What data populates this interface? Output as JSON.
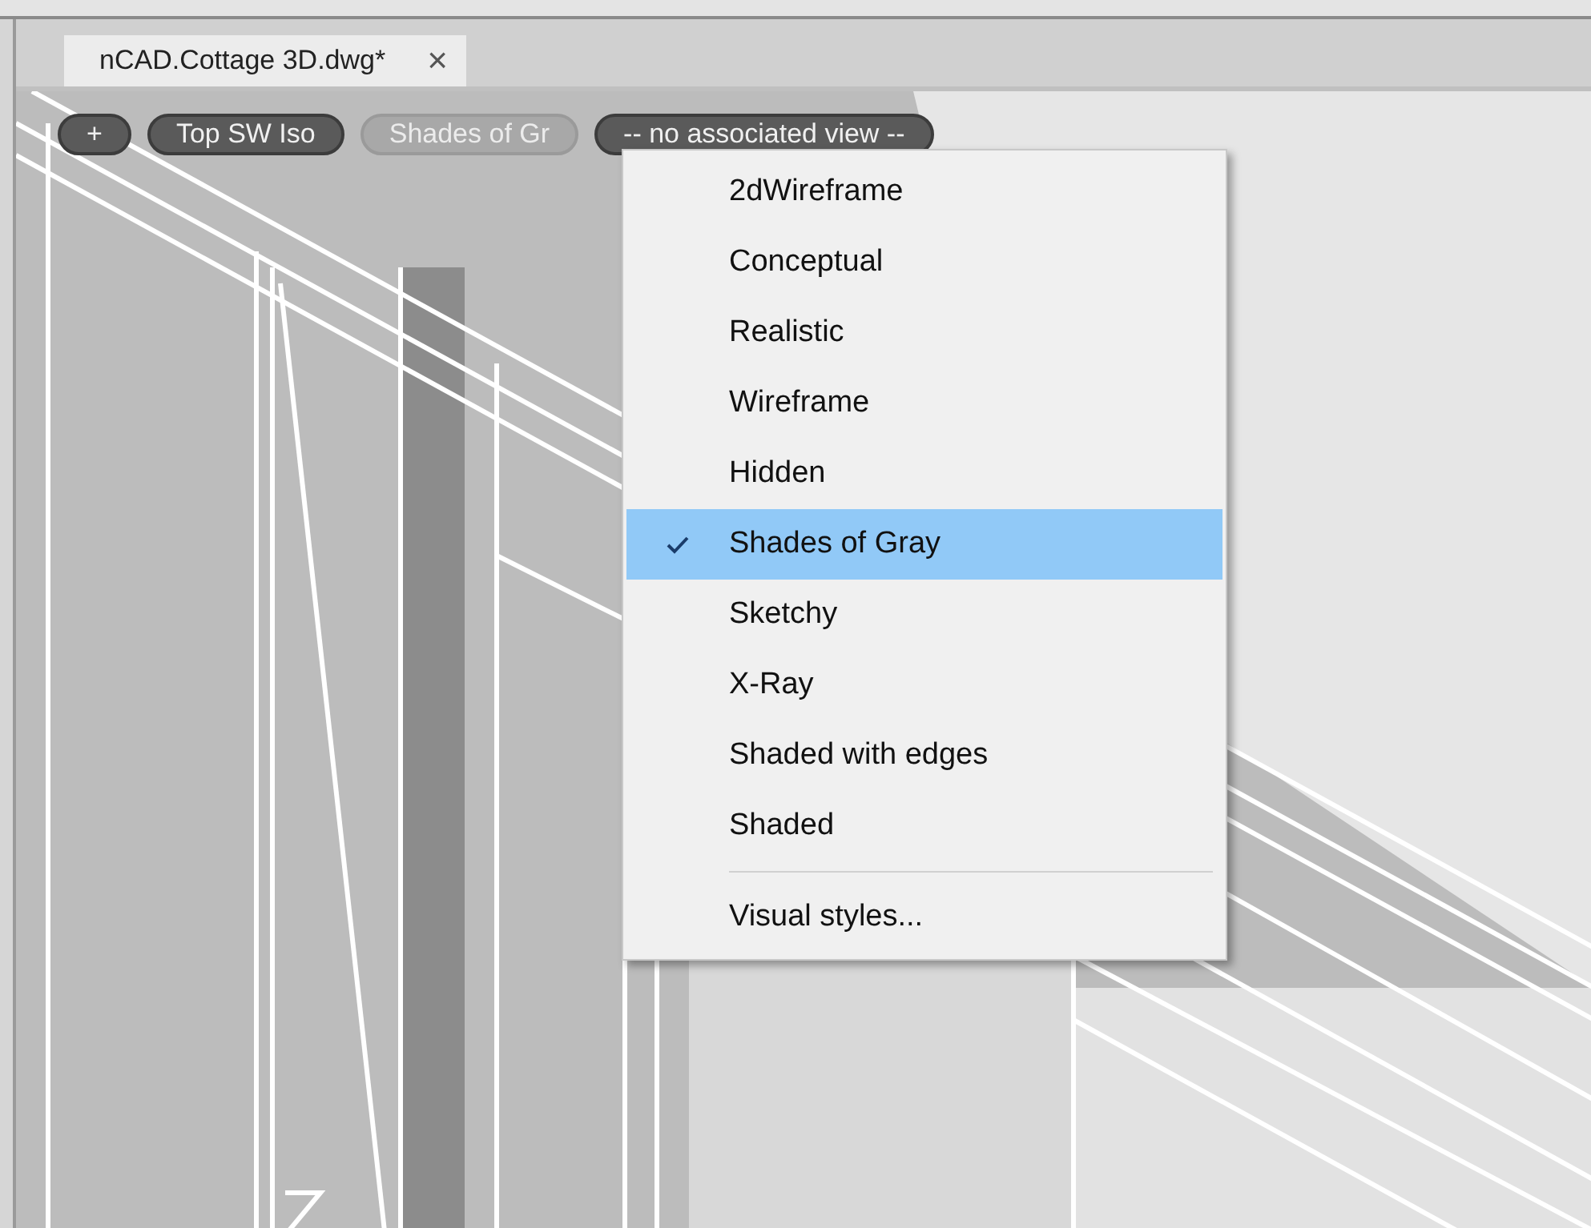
{
  "document_tab": {
    "title": "nCAD.Cottage 3D.dwg*",
    "close": "×"
  },
  "viewport_controls": [
    {
      "label": "+",
      "kind": "dark"
    },
    {
      "label": "Top SW Iso",
      "kind": "dark"
    },
    {
      "label": "Shades of Gr",
      "kind": "light"
    },
    {
      "label": "-- no associated view --",
      "kind": "dark"
    }
  ],
  "visual_style_menu": {
    "items": [
      {
        "label": "2dWireframe",
        "selected": false
      },
      {
        "label": "Conceptual",
        "selected": false
      },
      {
        "label": "Realistic",
        "selected": false
      },
      {
        "label": "Wireframe",
        "selected": false
      },
      {
        "label": "Hidden",
        "selected": false
      },
      {
        "label": "Shades of Gray",
        "selected": true
      },
      {
        "label": "Sketchy",
        "selected": false
      },
      {
        "label": "X-Ray",
        "selected": false
      },
      {
        "label": "Shaded with edges",
        "selected": false
      },
      {
        "label": "Shaded",
        "selected": false
      }
    ],
    "footer_item": "Visual styles..."
  }
}
